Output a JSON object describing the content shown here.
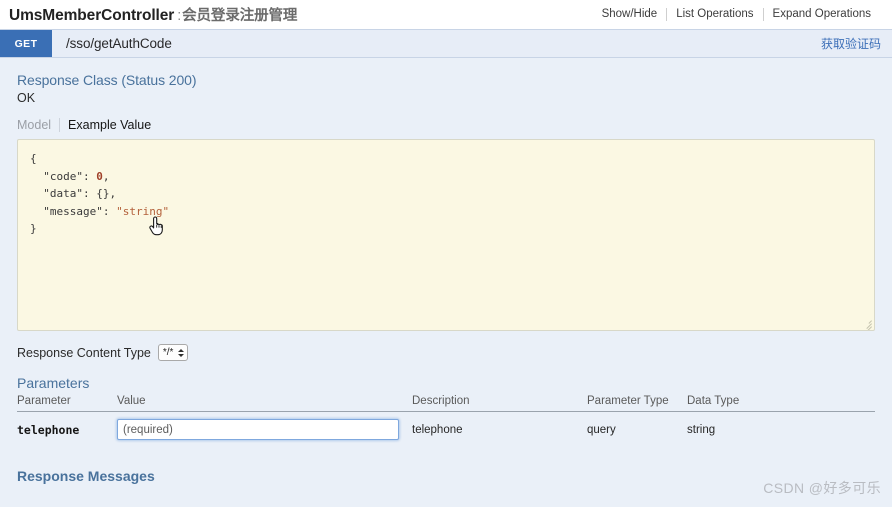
{
  "resource": {
    "controller_name": "UmsMemberController",
    "separator": ":",
    "description": "会员登录注册管理",
    "options": [
      {
        "label": "Show/Hide",
        "name": "show-hide"
      },
      {
        "label": "List Operations",
        "name": "list-operations"
      },
      {
        "label": "Expand Operations",
        "name": "expand-operations"
      }
    ]
  },
  "operation": {
    "method": "GET",
    "path": "/sso/getAuthCode",
    "summary": "获取验证码"
  },
  "response_class": {
    "heading": "Response Class (Status 200)",
    "status_text": "OK",
    "tabs": [
      {
        "label": "Model",
        "active": false
      },
      {
        "label": "Example Value",
        "active": true
      }
    ],
    "example_value": "{\n  \"code\": 0,\n  \"data\": {},\n  \"message\": \"string\"\n}",
    "example_lines": [
      {
        "indent": 0,
        "text": "{"
      },
      {
        "indent": 1,
        "key": "\"code\"",
        "value": "0",
        "kind": "number",
        "trailing": ","
      },
      {
        "indent": 1,
        "key": "\"data\"",
        "value": "{}",
        "kind": "object",
        "trailing": ","
      },
      {
        "indent": 1,
        "key": "\"message\"",
        "value": "\"string\"",
        "kind": "string",
        "trailing": ""
      },
      {
        "indent": 0,
        "text": "}"
      }
    ]
  },
  "content_type": {
    "label": "Response Content Type",
    "selected": "*/*",
    "options": [
      "*/*"
    ]
  },
  "parameters": {
    "title": "Parameters",
    "columns": [
      "Parameter",
      "Value",
      "Description",
      "Parameter Type",
      "Data Type"
    ],
    "rows": [
      {
        "parameter": "telephone",
        "value": "",
        "value_placeholder": "(required)",
        "description": "telephone",
        "parameter_type": "query",
        "data_type": "string"
      }
    ]
  },
  "response_messages": {
    "title": "Response Messages"
  },
  "watermark": {
    "text": "CSDN @好多可乐"
  },
  "colors": {
    "method_get": "#3a6fb5",
    "link_blue": "#3c6fb8",
    "section_heading": "#49729c",
    "page_bg": "#eaf0f8",
    "code_bg": "#fbf8e3",
    "op_bar_bg": "#e7edf7",
    "input_focus": "#7fa8de"
  }
}
